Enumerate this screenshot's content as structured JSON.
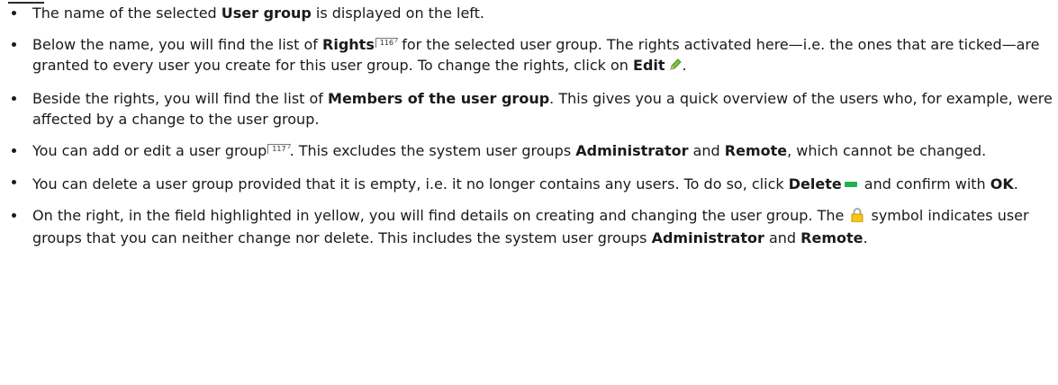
{
  "bullets": [
    {
      "t1": "The name of the selected ",
      "b1": "User group",
      "t2": " is displayed on the left."
    },
    {
      "t1": "Below the name, you will find the list of ",
      "b1": "Rights",
      "ref": "116",
      "t2": " for the selected user group. The rights activated here—i.e. the ones that are ticked—are granted to every user you create for this user group. To change the rights, click on ",
      "b2": "Edit",
      "t3": "."
    },
    {
      "t1": "Beside the rights, you will find the list of ",
      "b1": "Members of the user group",
      "t2": ". This gives you a quick overview of the users who, for example, were affected by a change to the user group."
    },
    {
      "t1": "You can add or edit a user group",
      "ref": "117",
      "t2": ". This excludes the system user groups ",
      "b1": "Administrator",
      "t3": " and ",
      "b2": "Remote",
      "t4": ", which cannot be changed."
    },
    {
      "t1": "You can delete a user group provided that it is empty, i.e. it no longer contains any users. To do so, click ",
      "b1": "Delete",
      "t2": " and confirm with ",
      "b2": "OK",
      "t3": "."
    },
    {
      "t1": "On the right, in the field highlighted in yellow, you will find details on creating and changing the user group. The ",
      "t2": " symbol indicates user groups that you can neither change nor delete. This includes the system user groups ",
      "b1": "Administrator",
      "t3": " and ",
      "b2": "Remote",
      "t4": "."
    }
  ],
  "icons": {
    "pencil": "pencil-icon",
    "minus": "minus-icon",
    "lock": "lock-icon",
    "pencil_color": "#7cc242",
    "minus_color": "#22b14c",
    "lock_color": "#f5c518"
  }
}
